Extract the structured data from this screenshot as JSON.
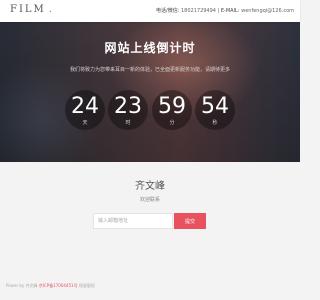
{
  "header": {
    "logo_text": "FILM",
    "logo_dot": ".",
    "phone_label": "电话/微信:",
    "phone": "18021729494",
    "email_label": "E-MAIL:",
    "email": "wenfengqi@126.com"
  },
  "hero": {
    "title": "网站上线倒计时",
    "subtitle": "我们将致力为您带来耳目一新的体验，已全面更新服务功能，请期待更多"
  },
  "countdown": [
    {
      "value": "24",
      "unit": "天"
    },
    {
      "value": "23",
      "unit": "时"
    },
    {
      "value": "59",
      "unit": "分"
    },
    {
      "value": "54",
      "unit": "秒"
    }
  ],
  "contact_section": {
    "name": "齐文峰",
    "subtitle": "欢迎联系"
  },
  "form": {
    "email_placeholder": "输入邮箱地址",
    "submit_label": "提交"
  },
  "footer": {
    "prefix": "Power by 齐文峰",
    "link": "京ICP备17004451号",
    "suffix": " 保留版权"
  },
  "colors": {
    "accent": "#e8525f"
  }
}
